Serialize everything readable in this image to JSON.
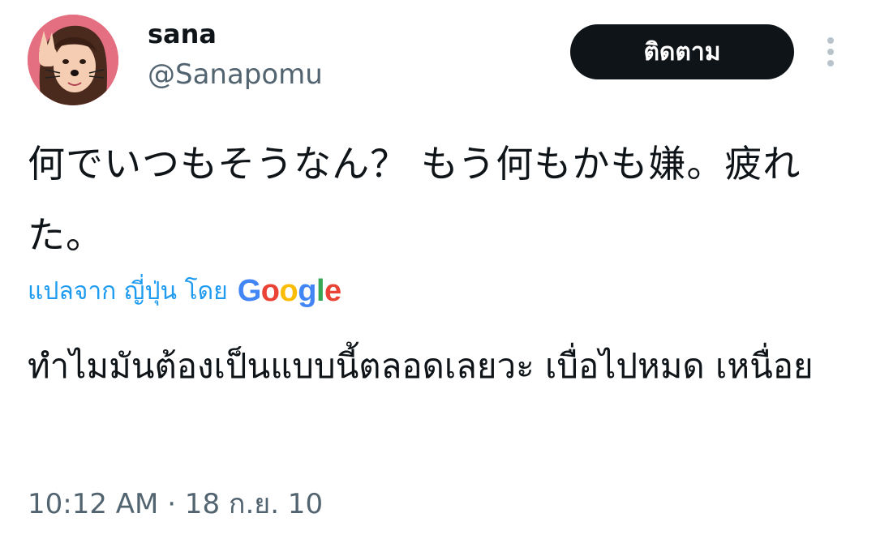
{
  "user": {
    "display_name": "sana",
    "handle": "@Sanapomu"
  },
  "actions": {
    "follow_label": "ติดตาม",
    "more_icon": "more-vertical-icon"
  },
  "tweet": {
    "text": "何でいつもそうなん？ もう何もかも嫌。疲れた。",
    "translate_label": "แปลจาก ญี่ปุ่น โดย",
    "translator": "Google",
    "translated_text": "ทำไมมันต้องเป็นแบบนี้ตลอดเลยวะ เบื่อไปหมด เหนื่อย",
    "timestamp": "10:12 AM · 18 ก.ย. 10"
  },
  "colors": {
    "text_primary": "#0f1419",
    "text_secondary": "#536471",
    "link": "#1d9bf0",
    "button_bg": "#0f1419",
    "google_blue": "#4285F4",
    "google_red": "#EA4335",
    "google_yellow": "#FBBC05",
    "google_green": "#34A853"
  }
}
